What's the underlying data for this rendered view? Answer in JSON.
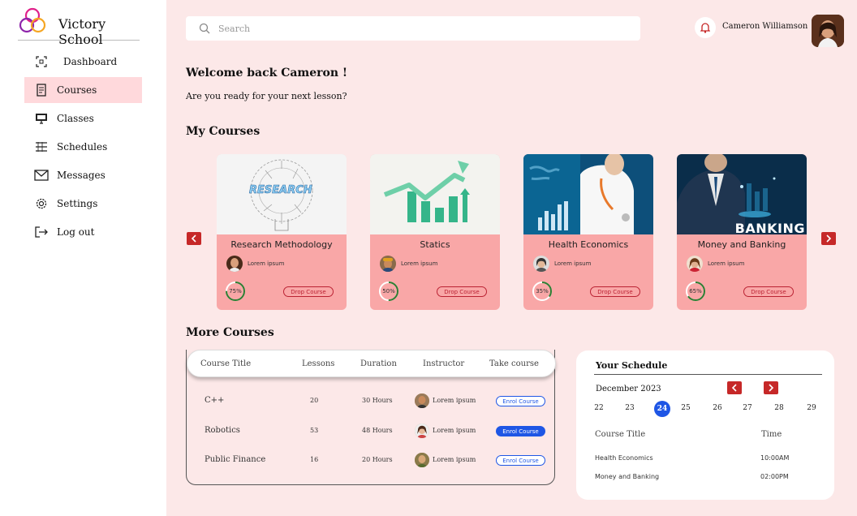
{
  "brand": {
    "name": "Victory School"
  },
  "sidebar": {
    "items": [
      {
        "label": "Dashboard",
        "icon": "dashboard-icon"
      },
      {
        "label": "Courses",
        "icon": "book-icon",
        "active": true
      },
      {
        "label": "Classes",
        "icon": "monitor-icon"
      },
      {
        "label": "Schedules",
        "icon": "calendar-list-icon"
      },
      {
        "label": "Messages",
        "icon": "mail-icon"
      },
      {
        "label": "Settings",
        "icon": "gear-icon"
      },
      {
        "label": "Log out",
        "icon": "logout-icon"
      }
    ]
  },
  "header": {
    "search_placeholder": "Search",
    "user_name": "Cameron Williamson"
  },
  "welcome": {
    "title": "Welcome back Cameron !",
    "subtitle": "Are you ready for your next lesson?"
  },
  "my_courses": {
    "heading": "My Courses",
    "cards": [
      {
        "title": "Research Methodology",
        "author": "Lorem ipsum",
        "progress": "75%",
        "progress_value": 0.75,
        "action": "Drop Course",
        "image_text": "RESEARCH"
      },
      {
        "title": "Statics",
        "author": "Lorem ipsum",
        "progress": "50%",
        "progress_value": 0.5,
        "action": "Drop Course"
      },
      {
        "title": "Health Economics",
        "author": "Lorem ipsum",
        "progress": "35%",
        "progress_value": 0.35,
        "action": "Drop Course"
      },
      {
        "title": "Money and Banking",
        "author": "Lorem ipsum",
        "progress": "65%",
        "progress_value": 0.65,
        "action": "Drop Course",
        "image_text": "BANKING"
      }
    ]
  },
  "more_courses": {
    "heading": "More Courses",
    "columns": [
      "Course Title",
      "Lessons",
      "Duration",
      "Instructor",
      "Take course"
    ],
    "rows": [
      {
        "title": "C++",
        "lessons": "20",
        "duration": "30 Hours",
        "instructor": "Lorem ipsum",
        "action": "Enrol Course",
        "highlight": false
      },
      {
        "title": "Robotics",
        "lessons": "53",
        "duration": "48 Hours",
        "instructor": "Lorem ipsum",
        "action": "Enrol Course",
        "highlight": true
      },
      {
        "title": "Public Finance",
        "lessons": "16",
        "duration": "20 Hours",
        "instructor": "Lorem ipsum",
        "action": "Enrol Course",
        "highlight": false
      }
    ]
  },
  "schedule": {
    "heading": "Your Schedule",
    "month": "December 2023",
    "days": [
      "22",
      "23",
      "24",
      "25",
      "26",
      "27",
      "28",
      "29"
    ],
    "active_day": "24",
    "col_course": "Course Title",
    "col_time": "Time",
    "items": [
      {
        "course": "Health Economics",
        "time": "10:00AM"
      },
      {
        "course": "Money and Banking",
        "time": "02:00PM"
      }
    ]
  },
  "colors": {
    "accent": "#c62828",
    "card_bg": "#f9a7a7",
    "page_bg": "#fce8e8",
    "active_nav": "#ffd9dc",
    "primary_blue": "#1e56e5",
    "progress_green": "#2e7d32"
  }
}
